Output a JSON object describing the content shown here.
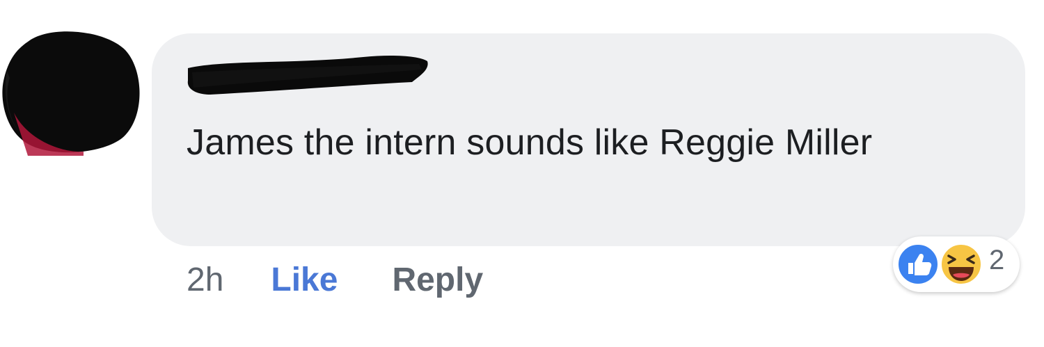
{
  "comment": {
    "text": "James the intern sounds like Reggie Miller"
  },
  "actions": {
    "timestamp": "2h",
    "like_label": "Like",
    "reply_label": "Reply"
  },
  "reactions": {
    "icons": [
      "like-icon",
      "haha-icon"
    ],
    "count": "2"
  },
  "colors": {
    "bubble": "#eff0f2",
    "link_blue": "#4a78d6",
    "muted": "#606770",
    "reaction_blue": "#3b82f0",
    "reaction_yellow": "#f7c544"
  }
}
